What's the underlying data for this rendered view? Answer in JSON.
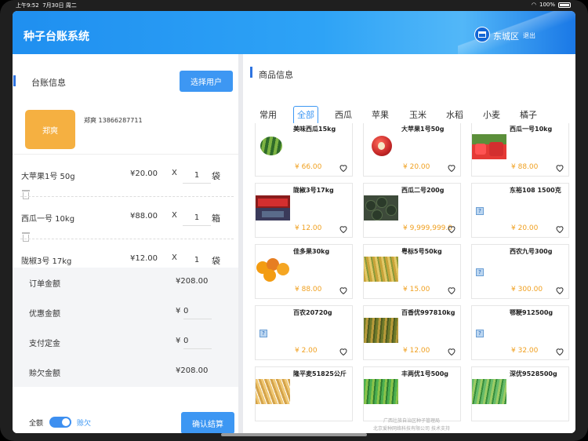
{
  "status_bar": {
    "time": "上午9:52",
    "date": "7月30日 周二",
    "battery": "100%"
  },
  "header": {
    "title": "种子台账系统",
    "district": "东城区",
    "logout": "退出"
  },
  "ledger": {
    "section_title": "台账信息",
    "select_user_label": "选择用户",
    "user_avatar_text": "郑爽",
    "user_name_phone": "郑爽 13866287711",
    "items": [
      {
        "name": "大苹果1号 50g",
        "price": "¥20.00",
        "x": "X",
        "qty": "1",
        "unit": "袋"
      },
      {
        "name": "西瓜一号 10kg",
        "price": "¥88.00",
        "x": "X",
        "qty": "1",
        "unit": "箱"
      },
      {
        "name": "陇椒3号 17kg",
        "price": "¥12.00",
        "x": "X",
        "qty": "1",
        "unit": "袋"
      }
    ],
    "summary": [
      {
        "label": "订单金额",
        "value": "¥208.00"
      },
      {
        "label": "优惠金额",
        "prefix": "¥",
        "value": "0"
      },
      {
        "label": "支付定金",
        "prefix": "¥",
        "value": "0"
      },
      {
        "label": "赊欠金额",
        "value": "¥208.00"
      }
    ],
    "toggle_left": "全额",
    "toggle_right": "赊欠",
    "confirm_label": "确认结算"
  },
  "products": {
    "section_title": "商品信息",
    "tabs": [
      "常用",
      "全部",
      "西瓜",
      "苹果",
      "玉米",
      "水稻",
      "小麦",
      "橘子"
    ],
    "active_tab": "全部",
    "items": [
      {
        "name": "美味西瓜15kg",
        "price": "¥ 66.00",
        "image": "watermelon"
      },
      {
        "name": "大苹果1号50g",
        "price": "¥ 20.00",
        "image": "apple"
      },
      {
        "name": "西瓜一号10kg",
        "price": "¥ 88.00",
        "image": "watermelon-slice"
      },
      {
        "name": "陇椒3号17kg",
        "price": "¥ 12.00",
        "image": "street-sign"
      },
      {
        "name": "西瓜二号200g",
        "price": "¥ 9,999,999.0",
        "image": "dark-melons"
      },
      {
        "name": "东裕108 1500克",
        "price": "¥ 20.00",
        "image": "missing"
      },
      {
        "name": "佳多果30kg",
        "price": "¥ 88.00",
        "image": "oranges"
      },
      {
        "name": "粤标5号50kg",
        "price": "¥ 15.00",
        "image": "rice"
      },
      {
        "name": "西农九号300g",
        "price": "¥ 300.00",
        "image": "missing"
      },
      {
        "name": "百农20720g",
        "price": "¥ 2.00",
        "image": "missing"
      },
      {
        "name": "百香优997810kg",
        "price": "¥ 12.00",
        "image": "rice-field"
      },
      {
        "name": "鄂粳912500g",
        "price": "¥ 32.00",
        "image": "missing"
      },
      {
        "name": "隆平麦51825公斤",
        "price": "",
        "image": "wheat"
      },
      {
        "name": "丰两优1号500g",
        "price": "",
        "image": "green-field"
      },
      {
        "name": "深优9528500g",
        "price": "",
        "image": "green-field2"
      }
    ],
    "footer_line1": "广西壮族自治区种子管理局",
    "footer_line2": "北京爱种网络科技有限公司 技术支持"
  },
  "colors": {
    "accent": "#3d97f3",
    "price": "#f0a020",
    "avatar": "#f5b041"
  }
}
